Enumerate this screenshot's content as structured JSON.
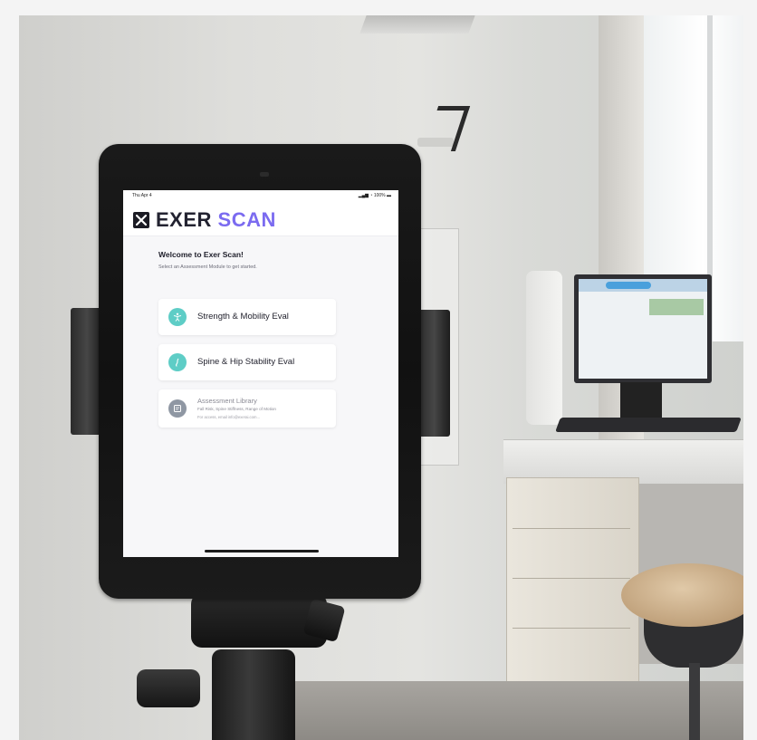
{
  "status_bar": {
    "time": "Thu Apr 4",
    "signal": "100%"
  },
  "app": {
    "brand_main": "EXER",
    "brand_accent": "SCAN",
    "accent_color": "#7b6bf0",
    "teal_color": "#5ecdc6"
  },
  "welcome": {
    "title": "Welcome to Exer Scan!",
    "subtitle": "Select an Assessment Module to get started."
  },
  "modules": [
    {
      "label": "Strength & Mobility Eval",
      "icon": "person-stretch-icon"
    },
    {
      "label": "Spine & Hip Stability Eval",
      "icon": "spine-icon"
    }
  ],
  "library": {
    "title": "Assessment Library",
    "description": "Fall Risk, Spine Stiffness, Range of Motion",
    "note": "For access, email info@exerai.com...",
    "icon": "library-icon"
  }
}
